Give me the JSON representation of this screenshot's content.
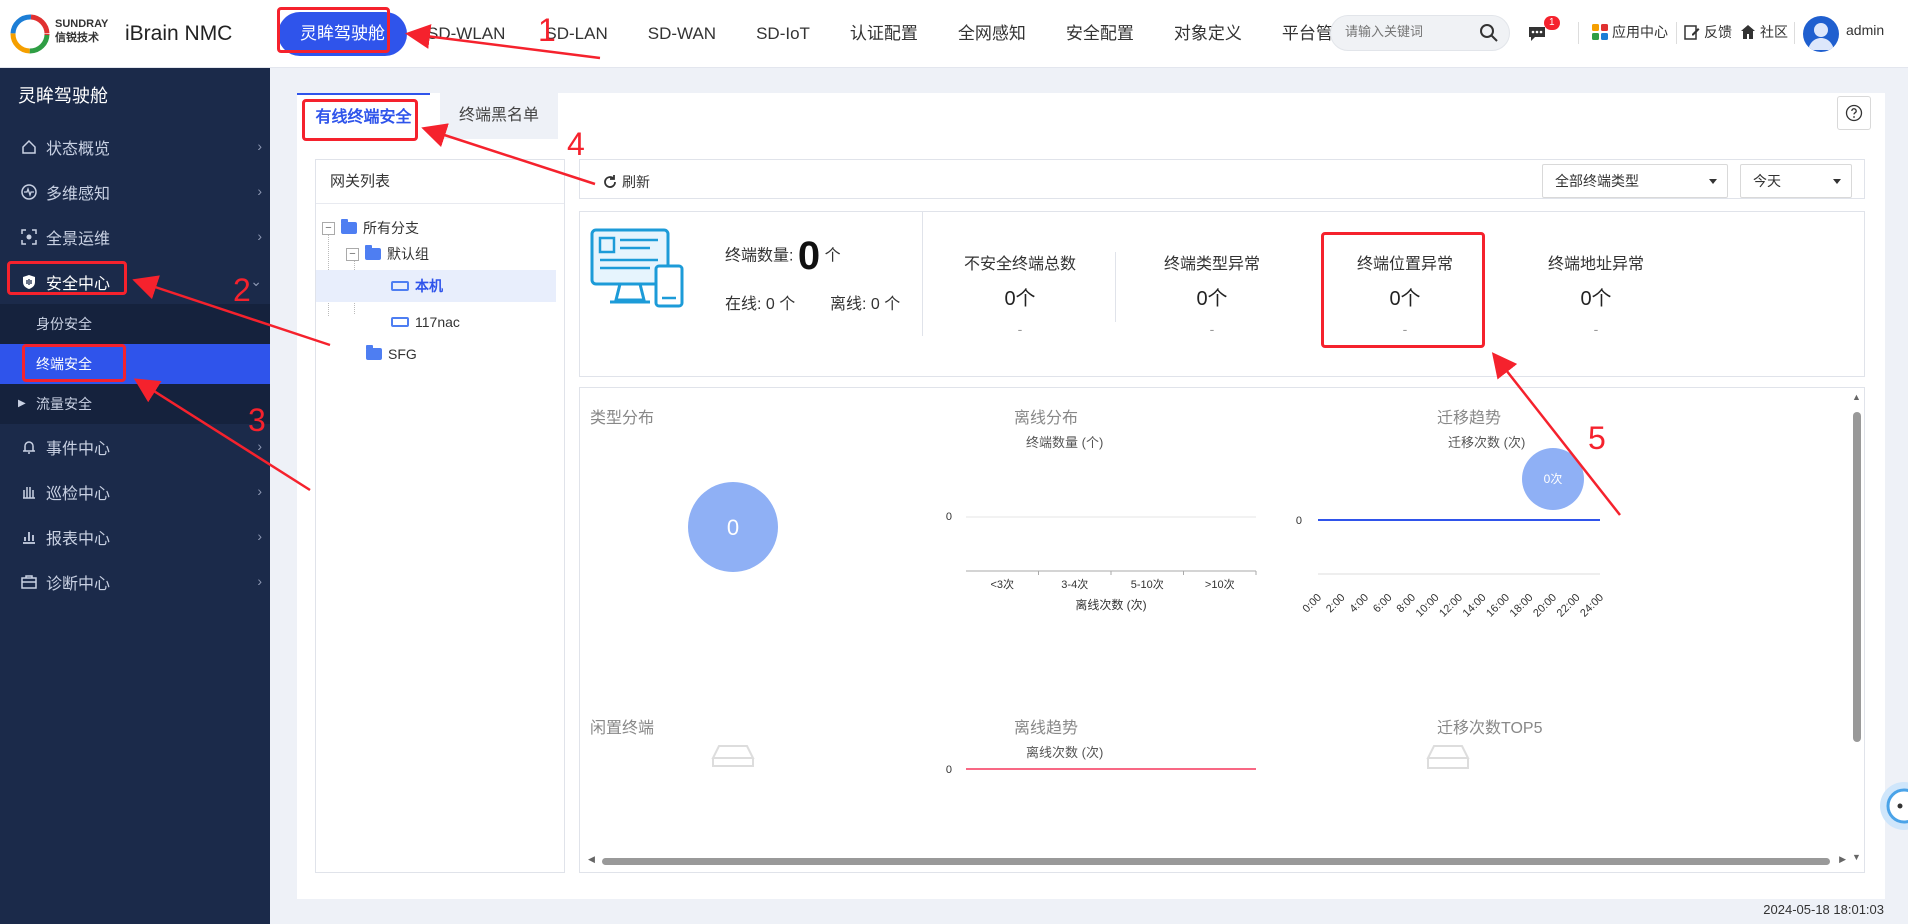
{
  "header": {
    "logo_line1": "SUNDRAY",
    "logo_line2": "信锐技术",
    "product": "iBrain NMC",
    "nav": [
      "灵眸驾驶舱",
      "SD-WLAN",
      "SD-LAN",
      "SD-WAN",
      "SD-IoT",
      "认证配置",
      "全网感知",
      "安全配置",
      "对象定义",
      "平台管理"
    ],
    "search_placeholder": "请输入关键词",
    "message_badge": "1",
    "app_center": "应用中心",
    "feedback": "反馈",
    "community": "社区",
    "user": "admin"
  },
  "sidebar": {
    "title": "灵眸驾驶舱",
    "items": [
      {
        "label": "状态概览",
        "icon": "home-icon"
      },
      {
        "label": "多维感知",
        "icon": "pulse-icon"
      },
      {
        "label": "全景运维",
        "icon": "scan-icon"
      },
      {
        "label": "安全中心",
        "icon": "shield-icon"
      },
      {
        "label": "事件中心",
        "icon": "bell-icon"
      },
      {
        "label": "巡检中心",
        "icon": "hand-icon"
      },
      {
        "label": "报表中心",
        "icon": "bar-chart-icon"
      },
      {
        "label": "诊断中心",
        "icon": "toolbox-icon"
      }
    ],
    "security_sub": [
      "身份安全",
      "终端安全",
      "流量安全"
    ]
  },
  "tabs": [
    "有线终端安全",
    "终端黑名单"
  ],
  "gateway": {
    "title": "网关列表",
    "tree": [
      "所有分支",
      "默认组",
      "本机",
      "117nac",
      "SFG"
    ]
  },
  "toolbar": {
    "refresh": "刷新",
    "type_select": "全部终端类型",
    "time_select": "今天"
  },
  "stats": {
    "total_label": "终端数量:",
    "total_value": "0",
    "total_unit": "个",
    "online": "在线: 0 个",
    "offline": "离线: 0 个",
    "cards": [
      {
        "label": "不安全终端总数",
        "value": "0个",
        "sub": "-"
      },
      {
        "label": "终端类型异常",
        "value": "0个",
        "sub": "-"
      },
      {
        "label": "终端位置异常",
        "value": "0个",
        "sub": "-"
      },
      {
        "label": "终端地址异常",
        "value": "0个",
        "sub": "-"
      }
    ]
  },
  "charts_text": {
    "type_dist": "类型分布",
    "type_dist_value": "0",
    "offline_dist": "离线分布",
    "offline_dist_y": "终端数量 (个)",
    "offline_dist_x": "离线次数 (次)",
    "migrate_trend": "迁移趋势",
    "migrate_trend_y": "迁移次数 (次)",
    "migrate_bubble": "0次",
    "idle": "闲置终端",
    "offline_trend": "离线趋势",
    "offline_trend_y": "离线次数 (次)",
    "migrate_top5": "迁移次数TOP5"
  },
  "chart_data": [
    {
      "type": "pie",
      "title": "类型分布",
      "values": [
        0
      ],
      "labels": [
        "0"
      ]
    },
    {
      "type": "bar",
      "title": "离线分布",
      "ylabel": "终端数量 (个)",
      "xlabel": "离线次数 (次)",
      "categories": [
        "<3次",
        "3-4次",
        "5-10次",
        ">10次"
      ],
      "values": [
        0,
        0,
        0,
        0
      ],
      "yticks": [
        "0"
      ]
    },
    {
      "type": "line",
      "title": "迁移趋势",
      "ylabel": "迁移次数 (次)",
      "categories": [
        "0:00",
        "2:00",
        "4:00",
        "6:00",
        "8:00",
        "10:00",
        "12:00",
        "14:00",
        "16:00",
        "18:00",
        "20:00",
        "22:00",
        "24:00"
      ],
      "values": [
        0,
        0,
        0,
        0,
        0,
        0,
        0,
        0,
        0,
        0,
        0,
        0,
        0
      ],
      "yticks": [
        "0"
      ],
      "bubble": "0次"
    },
    {
      "type": "line",
      "title": "离线趋势",
      "ylabel": "离线次数 (次)",
      "yticks": [
        "0"
      ]
    }
  ],
  "timestamp": "2024-05-18 18:01:03",
  "annotations": [
    "1",
    "2",
    "3",
    "4",
    "5"
  ],
  "colors": {
    "accent": "#2f54eb",
    "sidebar": "#1b2a4a",
    "annotation": "#f5222d",
    "bubble": "#8fb0f5"
  }
}
